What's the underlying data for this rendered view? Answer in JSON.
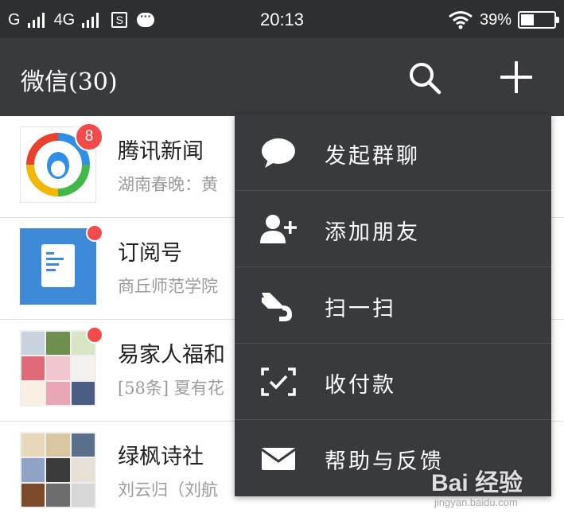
{
  "status_bar": {
    "carrier1": "G",
    "carrier2": "4G",
    "sim_icon_text": "S",
    "time": "20:13",
    "battery": "39%",
    "battery_level": 0.39,
    "icons": [
      "signal-icon",
      "signal-icon",
      "sim-icon",
      "chat-notification-icon",
      "wifi-icon",
      "battery-icon"
    ]
  },
  "header": {
    "title": "微信(30)",
    "search_icon": "search-icon",
    "add_icon": "plus-icon"
  },
  "chats": [
    {
      "name": "腾讯新闻",
      "preview": "湖南春晚：黄",
      "badge": "8",
      "avatar": "tencent-news-logo"
    },
    {
      "name": "订阅号",
      "preview": "商丘师范学院",
      "badge_dot": true,
      "avatar": "subscription-icon"
    },
    {
      "name": "易家人福和",
      "preview": "[58条] 夏有花",
      "badge_dot": true,
      "avatar": "group-avatar-grid"
    },
    {
      "name": "绿枫诗社",
      "preview": "刘云归（刘航",
      "avatar": "group-avatar-grid"
    }
  ],
  "menu": [
    {
      "label": "发起群聊",
      "icon": "chat-bubble-icon"
    },
    {
      "label": "添加朋友",
      "icon": "add-friend-icon"
    },
    {
      "label": "扫一扫",
      "icon": "scan-icon"
    },
    {
      "label": "收付款",
      "icon": "payment-scan-icon"
    },
    {
      "label": "帮助与反馈",
      "icon": "mail-icon"
    }
  ],
  "watermark": {
    "text": "Bai 经验",
    "sub": "jingyan.baidu.com"
  },
  "colors": {
    "status_bar_bg": "#2e2f31",
    "header_bg": "#393a3e",
    "menu_bg": "#393a3e",
    "badge": "#f44a4a",
    "subscription_blue": "#3e8ad8"
  }
}
